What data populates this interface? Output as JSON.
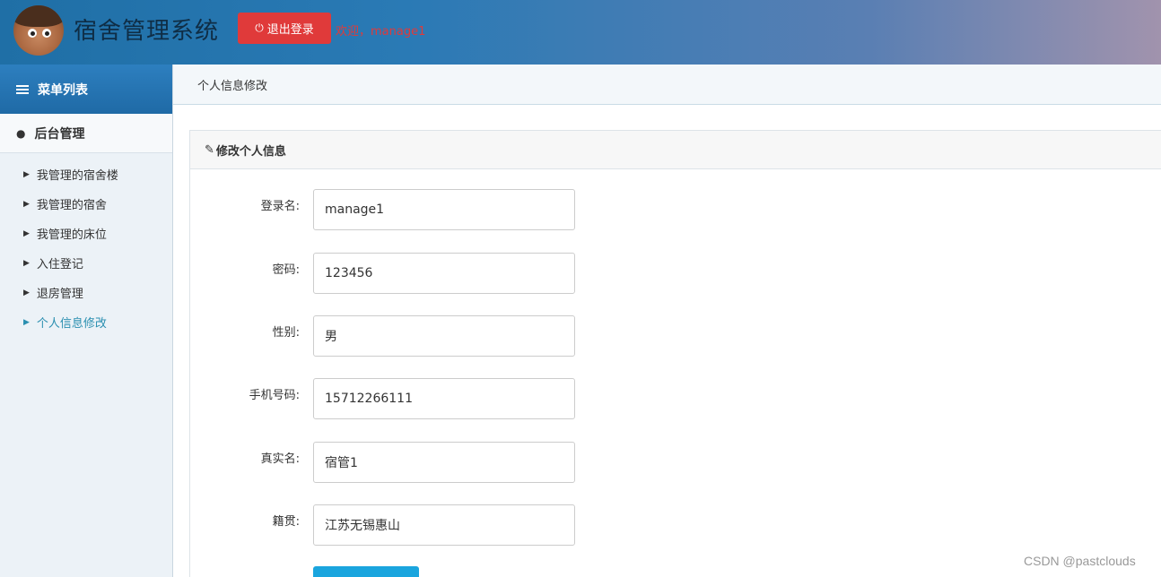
{
  "header": {
    "title": "宿舍管理系统",
    "logout_label": "退出登录",
    "welcome_text": "欢迎，manage1"
  },
  "sidebar": {
    "menu_title": "菜单列表",
    "group_title": "后台管理",
    "items": [
      {
        "label": "我管理的宿舍楼"
      },
      {
        "label": "我管理的宿舍"
      },
      {
        "label": "我管理的床位"
      },
      {
        "label": "入住登记"
      },
      {
        "label": "退房管理"
      },
      {
        "label": "个人信息修改"
      }
    ],
    "active_index": 5
  },
  "breadcrumb": "个人信息修改",
  "panel": {
    "title": "修改个人信息",
    "fields": [
      {
        "label": "登录名:",
        "value": "manage1"
      },
      {
        "label": "密码:",
        "value": "123456"
      },
      {
        "label": "性别:",
        "value": "男"
      },
      {
        "label": "手机号码:",
        "value": "15712266111"
      },
      {
        "label": "真实名:",
        "value": "宿管1"
      },
      {
        "label": "籍贯:",
        "value": "江苏无锡惠山"
      }
    ]
  },
  "watermark": "CSDN @pastclouds",
  "colors": {
    "header_gradient_start": "#1f6fa6",
    "logout_red": "#e03a3a",
    "active_item": "#2a8fb0",
    "submit_blue": "#1aa5de"
  }
}
